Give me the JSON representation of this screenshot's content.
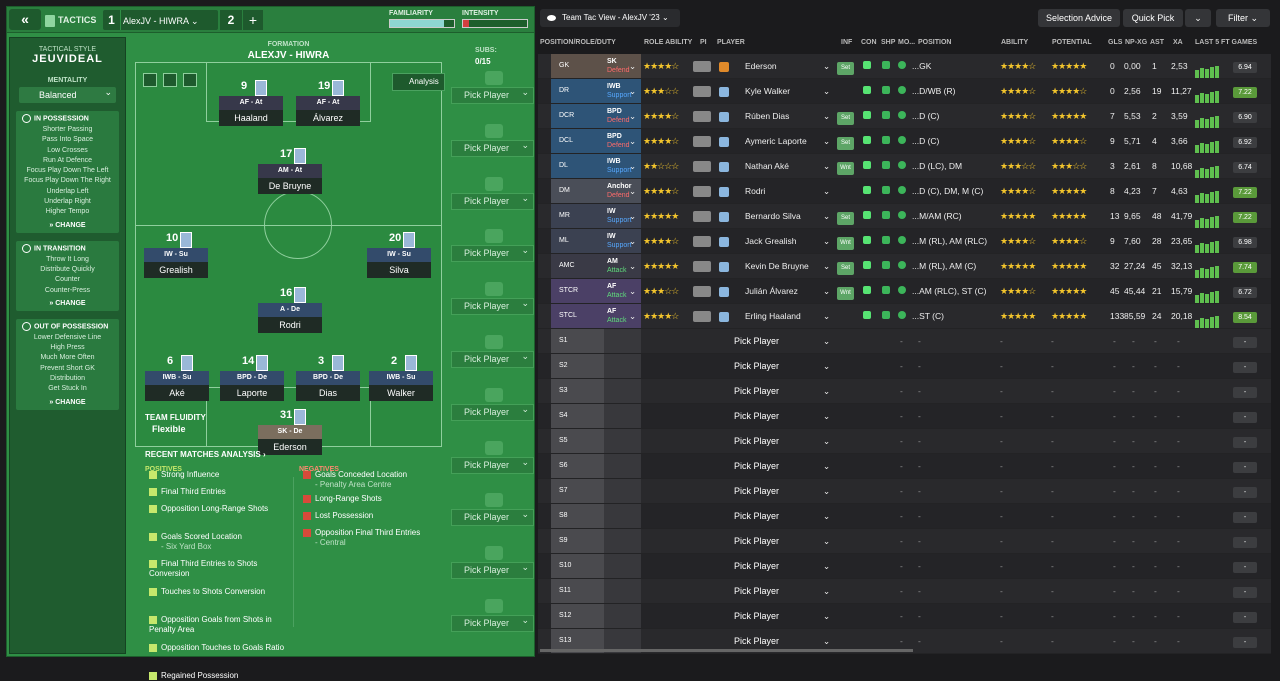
{
  "header": {
    "back": "«",
    "tactics": "TACTICS",
    "tab1_num": "1",
    "tab1_name": "AlexJV - HIWRA",
    "tab2_num": "2",
    "plus": "+",
    "familiarity": "FAMILIARITY",
    "intensity": "INTENSITY"
  },
  "sidebar": {
    "style_title": "TACTICAL STYLE",
    "style_name": "JEUVIDEAL",
    "mentality_title": "MENTALITY",
    "mentality": "Balanced",
    "in_possession": {
      "title": "IN POSSESSION",
      "items": [
        "Shorter Passing",
        "Pass Into Space",
        "Low Crosses",
        "Run At Defence",
        "Focus Play Down The Left",
        "Focus Play Down The Right",
        "Underlap Left",
        "Underlap Right",
        "Higher Tempo"
      ],
      "change": "CHANGE"
    },
    "in_transition": {
      "title": "IN TRANSITION",
      "items": [
        "Throw It Long",
        "Distribute Quickly",
        "Counter",
        "Counter-Press"
      ],
      "change": "CHANGE"
    },
    "out_of_possession": {
      "title": "OUT OF POSSESSION",
      "items": [
        "Lower Defensive Line",
        "High Press",
        "Much More Often",
        "Prevent Short GK",
        "Distribution",
        "Get Stuck In"
      ],
      "change": "CHANGE"
    }
  },
  "formation": {
    "title": "FORMATION",
    "name": "ALEXJV - HIWRA",
    "analysis": "Analysis",
    "subs_title": "SUBS:",
    "subs_value": "0/15",
    "fluidity_title": "TEAM FLUIDITY",
    "fluidity": "Flexible"
  },
  "pitch_players": [
    {
      "num": "9",
      "role": "AF - At",
      "name": "Haaland"
    },
    {
      "num": "19",
      "role": "AF - At",
      "name": "Álvarez"
    },
    {
      "num": "17",
      "role": "AM - At",
      "name": "De Bruyne"
    },
    {
      "num": "10",
      "role": "IW - Su",
      "name": "Grealish"
    },
    {
      "num": "20",
      "role": "IW - Su",
      "name": "Silva"
    },
    {
      "num": "16",
      "role": "A - De",
      "name": "Rodri"
    },
    {
      "num": "6",
      "role": "IWB - Su",
      "name": "Aké"
    },
    {
      "num": "14",
      "role": "BPD - De",
      "name": "Laporte"
    },
    {
      "num": "3",
      "role": "BPD - De",
      "name": "Dias"
    },
    {
      "num": "2",
      "role": "IWB - Su",
      "name": "Walker"
    },
    {
      "num": "31",
      "role": "SK - De",
      "name": "Ederson"
    }
  ],
  "subs": [
    "Pick Player",
    "Pick Player",
    "Pick Player",
    "Pick Player",
    "Pick Player",
    "Pick Player",
    "Pick Player",
    "Pick Player",
    "Pick Player",
    "Pick Player",
    "Pick Player"
  ],
  "analysis": {
    "title": "RECENT MATCHES ANALYSIS ›",
    "positives_title": "POSITIVES",
    "negatives_title": "NEGATIVES",
    "positives": [
      {
        "t": "Strong Influence",
        "s": ""
      },
      {
        "t": "Final Third Entries",
        "s": ""
      },
      {
        "t": "Opposition Long-Range Shots",
        "s": ""
      },
      {
        "t": "Goals Scored Location",
        "s": "- Six Yard Box"
      },
      {
        "t": "Final Third Entries to Shots Conversion",
        "s": ""
      },
      {
        "t": "Touches to Shots Conversion",
        "s": ""
      },
      {
        "t": "Opposition Goals from Shots in Penalty Area",
        "s": ""
      },
      {
        "t": "Opposition Touches to Goals Ratio",
        "s": ""
      },
      {
        "t": "Regained Possession",
        "s": ""
      }
    ],
    "negatives": [
      {
        "t": "Goals Conceded Location",
        "s": "- Penalty Area Centre"
      },
      {
        "t": "Long-Range Shots",
        "s": ""
      },
      {
        "t": "Lost Possession",
        "s": ""
      },
      {
        "t": "Opposition Final Third Entries",
        "s": "- Central"
      }
    ]
  },
  "right_toolbar": {
    "view": "Team Tac View - AlexJV '23",
    "selection_advice": "Selection Advice",
    "quick_pick": "Quick Pick",
    "filter": "Filter"
  },
  "columns": [
    "POSITION/ROLE/DUTY",
    "ROLE ABILITY",
    "PI",
    "PLAYER",
    "INF",
    "CON",
    "SHP",
    "MO...",
    "POSITION",
    "ABILITY",
    "POTENTIAL",
    "GLS",
    "NP-XG",
    "AST",
    "XA",
    "LAST 5 FT GAMES"
  ],
  "rows": [
    {
      "pos": "GK",
      "role": "SK",
      "duty": "Defend",
      "name": "Ederson",
      "inf": "Set",
      "position": "...GK",
      "gls": "0",
      "npxg": "0,00",
      "ast": "1",
      "xa": "2,53",
      "rating": "6.94",
      "good": false,
      "ra": 4,
      "ab": 4,
      "pot": 5
    },
    {
      "pos": "DR",
      "role": "IWB",
      "duty": "Support",
      "name": "Kyle Walker",
      "inf": "",
      "position": "...D/WB (R)",
      "gls": "0",
      "npxg": "2,56",
      "ast": "19",
      "xa": "11,27",
      "rating": "7.22",
      "good": true,
      "ra": 3,
      "ab": 4,
      "pot": 4
    },
    {
      "pos": "DCR",
      "role": "BPD",
      "duty": "Defend",
      "name": "Rúben Dias",
      "inf": "Set",
      "position": "...D (C)",
      "gls": "7",
      "npxg": "5,53",
      "ast": "2",
      "xa": "3,59",
      "rating": "6.90",
      "good": false,
      "ra": 4,
      "ab": 4,
      "pot": 5
    },
    {
      "pos": "DCL",
      "role": "BPD",
      "duty": "Defend",
      "name": "Aymeric Laporte",
      "inf": "Set",
      "position": "...D (C)",
      "gls": "9",
      "npxg": "5,71",
      "ast": "4",
      "xa": "3,66",
      "rating": "6.92",
      "good": false,
      "ra": 4,
      "ab": 4,
      "pot": 4
    },
    {
      "pos": "DL",
      "role": "IWB",
      "duty": "Support",
      "name": "Nathan Aké",
      "inf": "Wnt",
      "position": "...D (LC), DM",
      "gls": "3",
      "npxg": "2,61",
      "ast": "8",
      "xa": "10,68",
      "rating": "6.74",
      "good": false,
      "ra": 2,
      "ab": 3,
      "pot": 3
    },
    {
      "pos": "DM",
      "role": "Anchor",
      "duty": "Defend",
      "name": "Rodri",
      "inf": "",
      "position": "...D (C), DM, M (C)",
      "gls": "8",
      "npxg": "4,23",
      "ast": "7",
      "xa": "4,63",
      "rating": "7.22",
      "good": true,
      "ra": 4,
      "ab": 4,
      "pot": 5
    },
    {
      "pos": "MR",
      "role": "IW",
      "duty": "Support",
      "name": "Bernardo Silva",
      "inf": "Set",
      "position": "...M/AM (RC)",
      "gls": "13",
      "npxg": "9,65",
      "ast": "48",
      "xa": "41,79",
      "rating": "7.22",
      "good": true,
      "ra": 5,
      "ab": 5,
      "pot": 5
    },
    {
      "pos": "ML",
      "role": "IW",
      "duty": "Support",
      "name": "Jack Grealish",
      "inf": "Wnt",
      "position": "...M (RL), AM (RLC)",
      "gls": "9",
      "npxg": "7,60",
      "ast": "28",
      "xa": "23,65",
      "rating": "6.98",
      "good": false,
      "ra": 4,
      "ab": 4,
      "pot": 4
    },
    {
      "pos": "AMC",
      "role": "AM",
      "duty": "Attack",
      "name": "Kevin De Bruyne",
      "inf": "Set",
      "position": "...M (RL), AM (C)",
      "gls": "32",
      "npxg": "27,24",
      "ast": "45",
      "xa": "32,13",
      "rating": "7.74",
      "good": true,
      "ra": 5,
      "ab": 5,
      "pot": 5
    },
    {
      "pos": "STCR",
      "role": "AF",
      "duty": "Attack",
      "name": "Julián Álvarez",
      "inf": "Wnt",
      "position": "...AM (RLC), ST (C)",
      "gls": "45",
      "npxg": "45,44",
      "ast": "21",
      "xa": "15,79",
      "rating": "6.72",
      "good": false,
      "ra": 3,
      "ab": 4,
      "pot": 5
    },
    {
      "pos": "STCL",
      "role": "AF",
      "duty": "Attack",
      "name": "Erling Haaland",
      "inf": "",
      "position": "...ST (C)",
      "gls": "133",
      "npxg": "85,59",
      "ast": "24",
      "xa": "20,18",
      "rating": "8.54",
      "good": true,
      "ra": 4,
      "ab": 5,
      "pot": 5
    }
  ],
  "sub_rows": [
    "S1",
    "S2",
    "S3",
    "S4",
    "S5",
    "S6",
    "S7",
    "S8",
    "S9",
    "S10",
    "S11",
    "S12",
    "S13"
  ],
  "pick_label": "Pick Player",
  "dash": "-"
}
